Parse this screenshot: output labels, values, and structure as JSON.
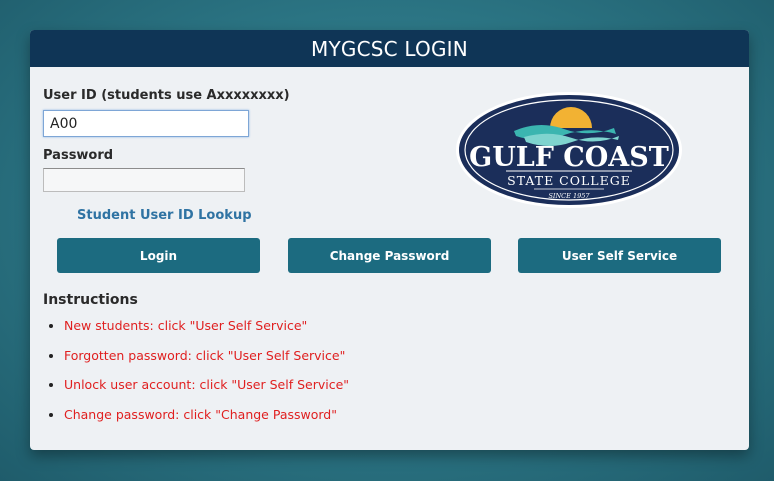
{
  "page": {
    "title": "MYGCSC LOGIN"
  },
  "form": {
    "userid_label": "User ID (students use Axxxxxxxx)",
    "userid_value": "A00",
    "password_label": "Password",
    "password_value": "",
    "lookup_link": "Student User ID Lookup"
  },
  "buttons": {
    "login": "Login",
    "change_password": "Change Password",
    "self_service": "User Self Service"
  },
  "logo": {
    "line1": "GULF COAST",
    "line2": "STATE COLLEGE",
    "line3": "SINCE 1957"
  },
  "instructions": {
    "title": "Instructions",
    "items": [
      "New students: click \"User Self Service\"",
      "Forgotten password: click \"User Self Service\"",
      "Unlock user account: click \"User Self Service\"",
      "Change password: click \"Change Password\""
    ]
  },
  "colors": {
    "header_bg": "#0f3556",
    "button_bg": "#1c6b80",
    "link": "#2f73a3",
    "instruction_text": "#e02020",
    "logo_navy": "#1b2e5a",
    "logo_sun": "#f2b233",
    "logo_wave": "#3bb5b0"
  }
}
